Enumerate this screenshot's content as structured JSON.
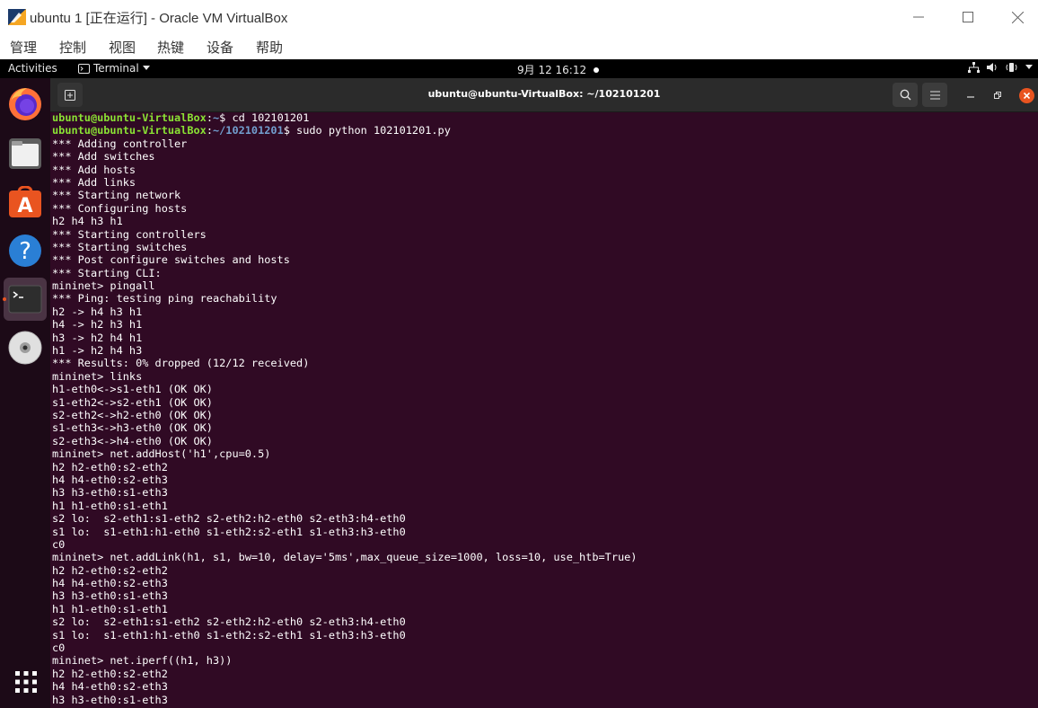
{
  "window": {
    "title": "ubuntu 1 [正在运行] - Oracle VM VirtualBox",
    "menu": [
      "管理",
      "控制",
      "视图",
      "热键",
      "设备",
      "帮助"
    ]
  },
  "topbar": {
    "activities": "Activities",
    "app_menu": "Terminal",
    "clock": "9月 12 16:12"
  },
  "dock": {
    "items": [
      "firefox-icon",
      "files-icon",
      "app-store-icon",
      "help-icon",
      "terminal-icon",
      "disc-icon"
    ],
    "apps_grid": "show-apps-icon"
  },
  "terminal": {
    "title": "ubuntu@ubuntu-VirtualBox: ~/102101201",
    "prompt1": {
      "user": "ubuntu@ubuntu-VirtualBox",
      "sep": ":",
      "path": "~",
      "cmd": "$ cd 102101201"
    },
    "prompt2": {
      "user": "ubuntu@ubuntu-VirtualBox",
      "sep": ":",
      "path": "~/102101201",
      "cmd": "$ sudo python 102101201.py"
    },
    "output": [
      "*** Adding controller",
      "*** Add switches",
      "*** Add hosts",
      "*** Add links",
      "*** Starting network",
      "*** Configuring hosts",
      "h2 h4 h3 h1",
      "*** Starting controllers",
      "*** Starting switches",
      "*** Post configure switches and hosts",
      "*** Starting CLI:",
      "mininet> pingall",
      "*** Ping: testing ping reachability",
      "h2 -> h4 h3 h1",
      "h4 -> h2 h3 h1",
      "h3 -> h2 h4 h1",
      "h1 -> h2 h4 h3",
      "*** Results: 0% dropped (12/12 received)",
      "mininet> links",
      "h1-eth0<->s1-eth1 (OK OK)",
      "s1-eth2<->s2-eth1 (OK OK)",
      "s2-eth2<->h2-eth0 (OK OK)",
      "s1-eth3<->h3-eth0 (OK OK)",
      "s2-eth3<->h4-eth0 (OK OK)",
      "mininet> net.addHost('h1',cpu=0.5)",
      "h2 h2-eth0:s2-eth2",
      "h4 h4-eth0:s2-eth3",
      "h3 h3-eth0:s1-eth3",
      "h1 h1-eth0:s1-eth1",
      "s2 lo:  s2-eth1:s1-eth2 s2-eth2:h2-eth0 s2-eth3:h4-eth0",
      "s1 lo:  s1-eth1:h1-eth0 s1-eth2:s2-eth1 s1-eth3:h3-eth0",
      "c0",
      "mininet> net.addLink(h1, s1, bw=10, delay='5ms',max_queue_size=1000, loss=10, use_htb=True)",
      "h2 h2-eth0:s2-eth2",
      "h4 h4-eth0:s2-eth3",
      "h3 h3-eth0:s1-eth3",
      "h1 h1-eth0:s1-eth1",
      "s2 lo:  s2-eth1:s1-eth2 s2-eth2:h2-eth0 s2-eth3:h4-eth0",
      "s1 lo:  s1-eth1:h1-eth0 s1-eth2:s2-eth1 s1-eth3:h3-eth0",
      "c0",
      "mininet> net.iperf((h1, h3))",
      "h2 h2-eth0:s2-eth2",
      "h4 h4-eth0:s2-eth3",
      "h3 h3-eth0:s1-eth3"
    ]
  },
  "colors": {
    "terminal_bg": "#300a24",
    "prompt_user": "#8ae234",
    "prompt_path": "#729fcf",
    "accent": "#e95420"
  }
}
